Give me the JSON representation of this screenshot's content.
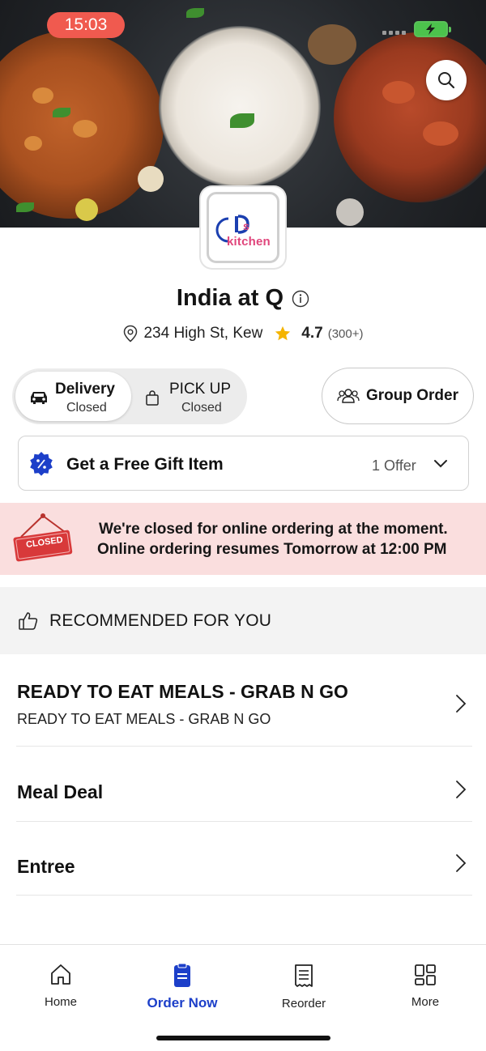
{
  "status_bar": {
    "time": "15:03"
  },
  "hero": {
    "search_icon": "search-icon"
  },
  "logo": {
    "prefix": "s",
    "word": "kitchen"
  },
  "store": {
    "name": "India at Q",
    "address": "234 High St, Kew",
    "rating": "4.7",
    "rating_count": "(300+)"
  },
  "modes": {
    "delivery": {
      "label": "Delivery",
      "status": "Closed",
      "selected": true
    },
    "pickup": {
      "label": "PICK UP",
      "status": "Closed",
      "selected": false
    },
    "group_order": "Group Order"
  },
  "offer": {
    "title": "Get a Free Gift Item",
    "count": "1 Offer"
  },
  "closed_notice": {
    "sign_text": "CLOSED",
    "line1": "We're closed for online ordering at the moment.",
    "line2": "Online ordering resumes Tomorrow at 12:00 PM"
  },
  "recommended": {
    "title": "RECOMMENDED FOR YOU"
  },
  "categories": [
    {
      "title": "READY TO EAT MEALS - GRAB N GO",
      "subtitle": "READY TO EAT MEALS - GRAB N GO"
    },
    {
      "title": "Meal Deal"
    },
    {
      "title": "Entree"
    }
  ],
  "bottom_nav": [
    {
      "label": "Home",
      "icon": "home-icon",
      "active": false
    },
    {
      "label": "Order Now",
      "icon": "order-icon",
      "active": true
    },
    {
      "label": "Reorder",
      "icon": "receipt-icon",
      "active": false
    },
    {
      "label": "More",
      "icon": "grid-icon",
      "active": false
    }
  ],
  "colors": {
    "accent": "#1c3fc9",
    "time_pill": "#f05a4f",
    "closed_banner": "#fadede",
    "rating_star": "#f4b400",
    "logo_pink": "#e0457b"
  }
}
